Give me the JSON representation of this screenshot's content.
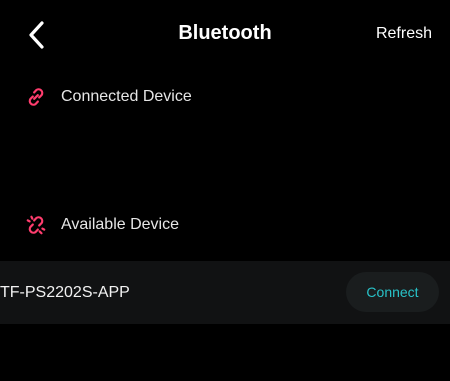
{
  "header": {
    "title": "Bluetooth",
    "refresh_label": "Refresh",
    "back_icon": "chevron-left-icon"
  },
  "sections": {
    "connected": {
      "label": "Connected Device",
      "icon": "link-icon"
    },
    "available": {
      "label": "Available Device",
      "icon": "link-broken-icon"
    }
  },
  "devices": [
    {
      "name": "TF-PS2202S-APP",
      "action_label": "Connect"
    }
  ],
  "colors": {
    "background": "#000000",
    "accent_pink": "#ff3d6e",
    "connect_text": "#28c2c8",
    "row_bg": "#111213",
    "button_bg": "#1a1d1e"
  }
}
